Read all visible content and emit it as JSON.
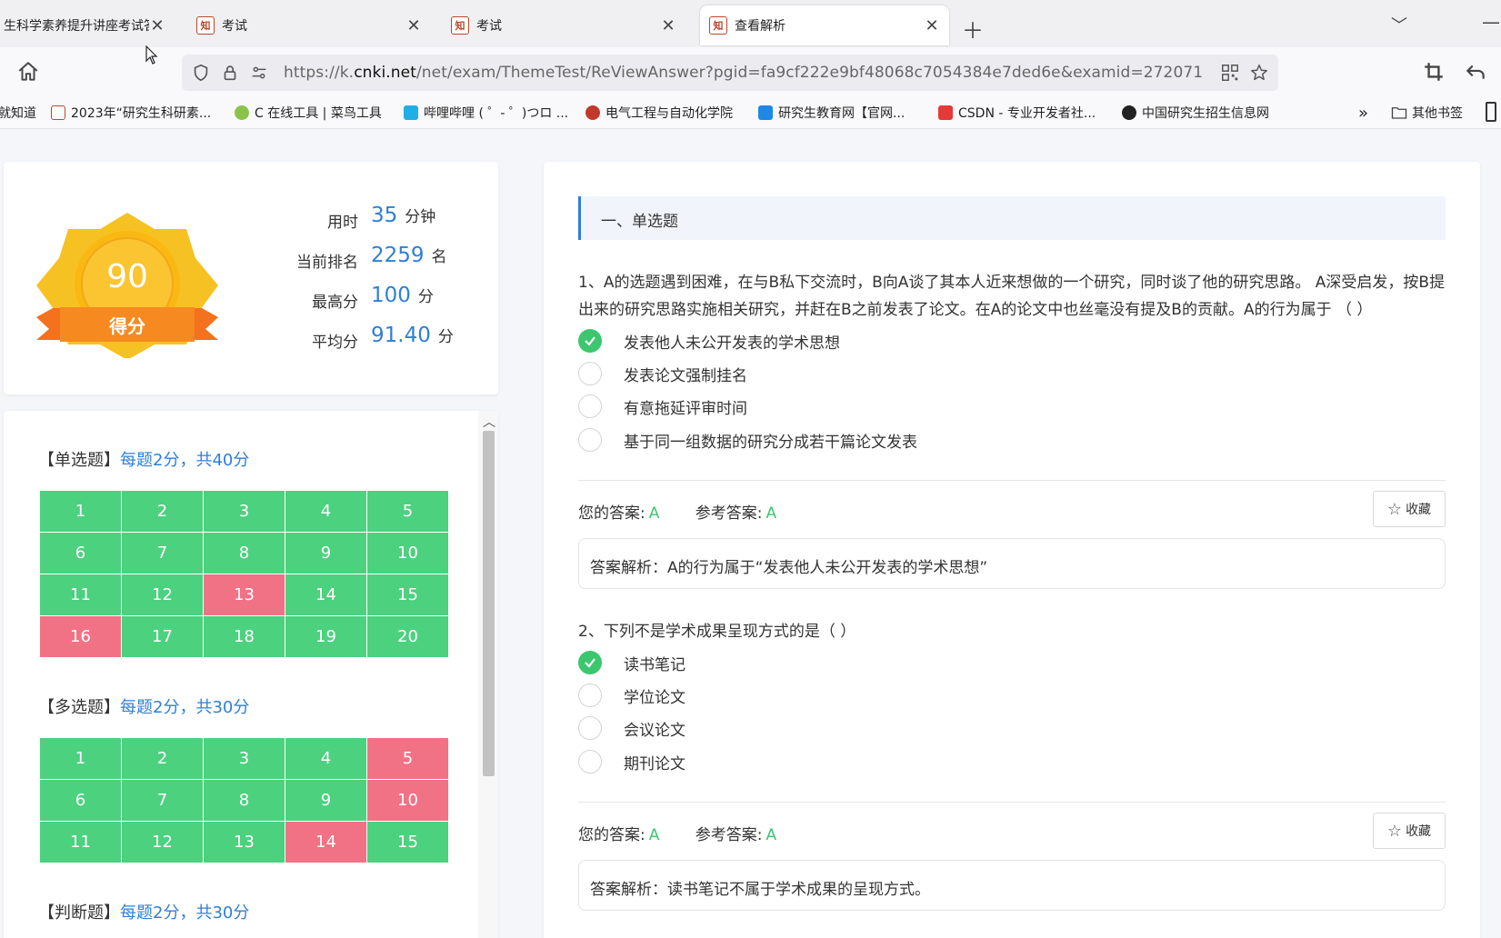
{
  "browser": {
    "tabs": [
      {
        "title": "生科学素养提升讲座考试答",
        "active": false
      },
      {
        "title": "考试",
        "active": false
      },
      {
        "title": "考试",
        "active": false
      },
      {
        "title": "查看解析",
        "active": true
      }
    ],
    "url_prefix": "https://k.",
    "url_domain": "cnki.net",
    "url_rest": "/net/exam/ThemeTest/ReViewAnswer?pgid=fa9cf222e9bf48068c7054384e7ded6e&examid=272071",
    "bookmarks": [
      "就知道",
      "2023年“研究生科研素...",
      "C 在线工具 | 菜鸟工具",
      "哔哩哔哩 ( ゜- ゜)つロ ...",
      "电气工程与自动化学院",
      "研究生教育网【官网...",
      "CSDN - 专业开发者社...",
      "中国研究生招生信息网"
    ],
    "other_bookmarks": "其他书签"
  },
  "score": {
    "value": "90",
    "label": "得分",
    "time_label": "用时",
    "time_value": "35",
    "time_unit": "分钟",
    "rank_label": "当前排名",
    "rank_value": "2259",
    "rank_unit": "名",
    "max_label": "最高分",
    "max_value": "100",
    "max_unit": "分",
    "avg_label": "平均分",
    "avg_value": "91.40",
    "avg_unit": "分"
  },
  "nav": {
    "single": {
      "title": "【单选题】",
      "hint": "每题2分，共40分",
      "cells": [
        "1",
        "2",
        "3",
        "4",
        "5",
        "6",
        "7",
        "8",
        "9",
        "10",
        "11",
        "12",
        "13",
        "14",
        "15",
        "16",
        "17",
        "18",
        "19",
        "20"
      ],
      "wrong": [
        "13",
        "16"
      ]
    },
    "multi": {
      "title": "【多选题】",
      "hint": "每题2分，共30分",
      "cells": [
        "1",
        "2",
        "3",
        "4",
        "5",
        "6",
        "7",
        "8",
        "9",
        "10",
        "11",
        "12",
        "13",
        "14",
        "15"
      ],
      "wrong": [
        "5",
        "10",
        "14"
      ]
    },
    "judge": {
      "title": "【判断题】",
      "hint": "每题2分，共30分"
    }
  },
  "section_title": "一、单选题",
  "questions": [
    {
      "text": "1、A的选题遇到困难，在与B私下交流时，B向A谈了其本人近来想做的一个研究，同时谈了他的研究思路。 A深受启发，按B提出来的研究思路实施相关研究，并赶在B之前发表了论文。在A的论文中也丝毫没有提及B的贡献。A的行为属于 （ ）",
      "options": [
        "发表他人未公开发表的学术思想",
        "发表论文强制挂名",
        "有意拖延评审时间",
        "基于同一组数据的研究分成若干篇论文发表"
      ],
      "selected": 0,
      "your_label": "您的答案:",
      "your": "A",
      "ref_label": "参考答案:",
      "ref": "A",
      "fav": "收藏",
      "analysis": "答案解析：A的行为属于“发表他人未公开发表的学术思想”"
    },
    {
      "text": "2、下列不是学术成果呈现方式的是（ ）",
      "options": [
        "读书笔记",
        "学位论文",
        "会议论文",
        "期刊论文"
      ],
      "selected": 0,
      "your_label": "您的答案:",
      "your": "A",
      "ref_label": "参考答案:",
      "ref": "A",
      "fav": "收藏",
      "analysis": "答案解析：读书笔记不属于学术成果的呈现方式。"
    }
  ],
  "colors": {
    "correct": "#4cd17f",
    "wrong": "#f17285",
    "accent": "#2f7fd6",
    "check": "#3cc66e"
  }
}
